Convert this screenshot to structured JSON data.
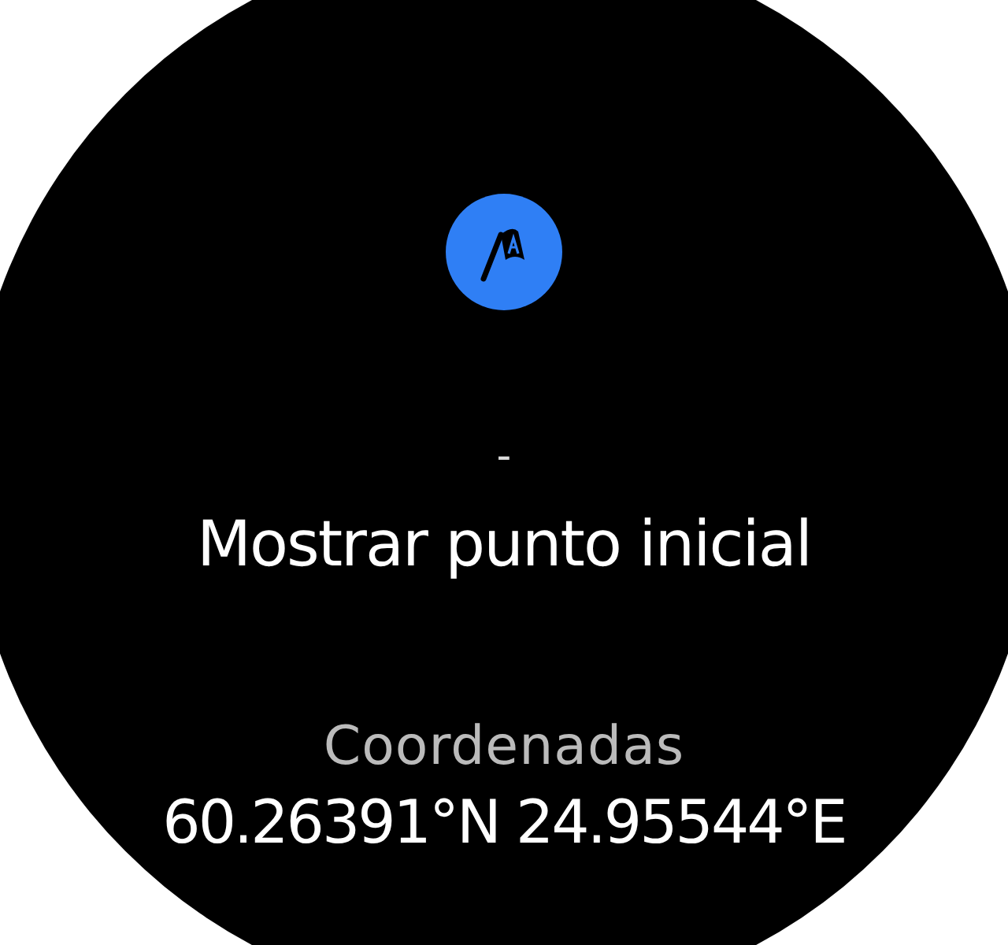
{
  "screen": {
    "icon": {
      "color": "#2f7ff5"
    },
    "value": "-",
    "title": "Mostrar punto inicial",
    "label": "Coordenadas",
    "coordinates": "60.26391°N 24.95544°E"
  }
}
